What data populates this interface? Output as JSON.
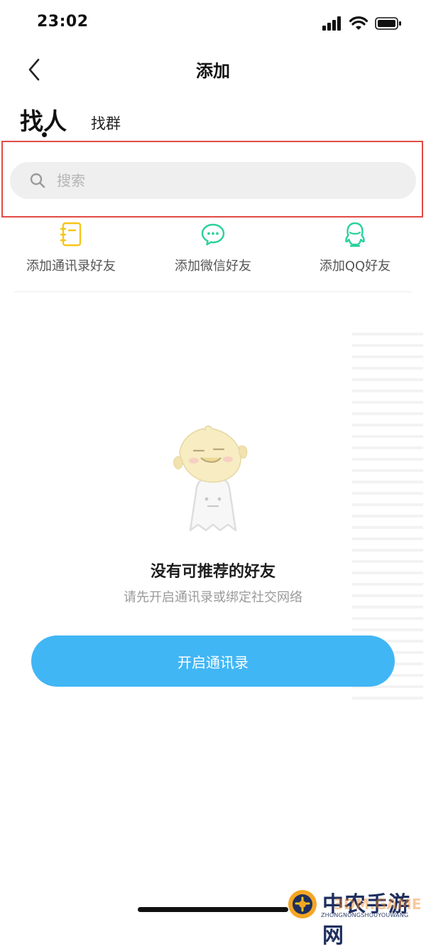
{
  "status_bar": {
    "time": "23:02"
  },
  "nav": {
    "title": "添加"
  },
  "tabs": [
    {
      "label": "找人",
      "active": true
    },
    {
      "label": "找群",
      "active": false
    }
  ],
  "search": {
    "placeholder": "搜索",
    "value": ""
  },
  "quick_add": [
    {
      "label": "添加通讯录好友",
      "icon": "contacts-book-icon",
      "color": "#f5c518"
    },
    {
      "label": "添加微信好友",
      "icon": "wechat-icon",
      "color": "#2bd19c"
    },
    {
      "label": "添加QQ好友",
      "icon": "qq-icon",
      "color": "#2bd19c"
    }
  ],
  "empty_state": {
    "title": "没有可推荐的好友",
    "subtitle": "请先开启通讯录或绑定社交网络",
    "button_label": "开启通讯录"
  },
  "watermark": {
    "site_name": "中农手游网",
    "site_domain": "ZHONGNONGSHOUYOUWANG",
    "overlay_text": "3DM.GAME"
  },
  "colors": {
    "accent": "#41b6f5",
    "highlight": "#e14b44",
    "contacts_icon": "#f5c518",
    "social_icon": "#2bd19c"
  }
}
